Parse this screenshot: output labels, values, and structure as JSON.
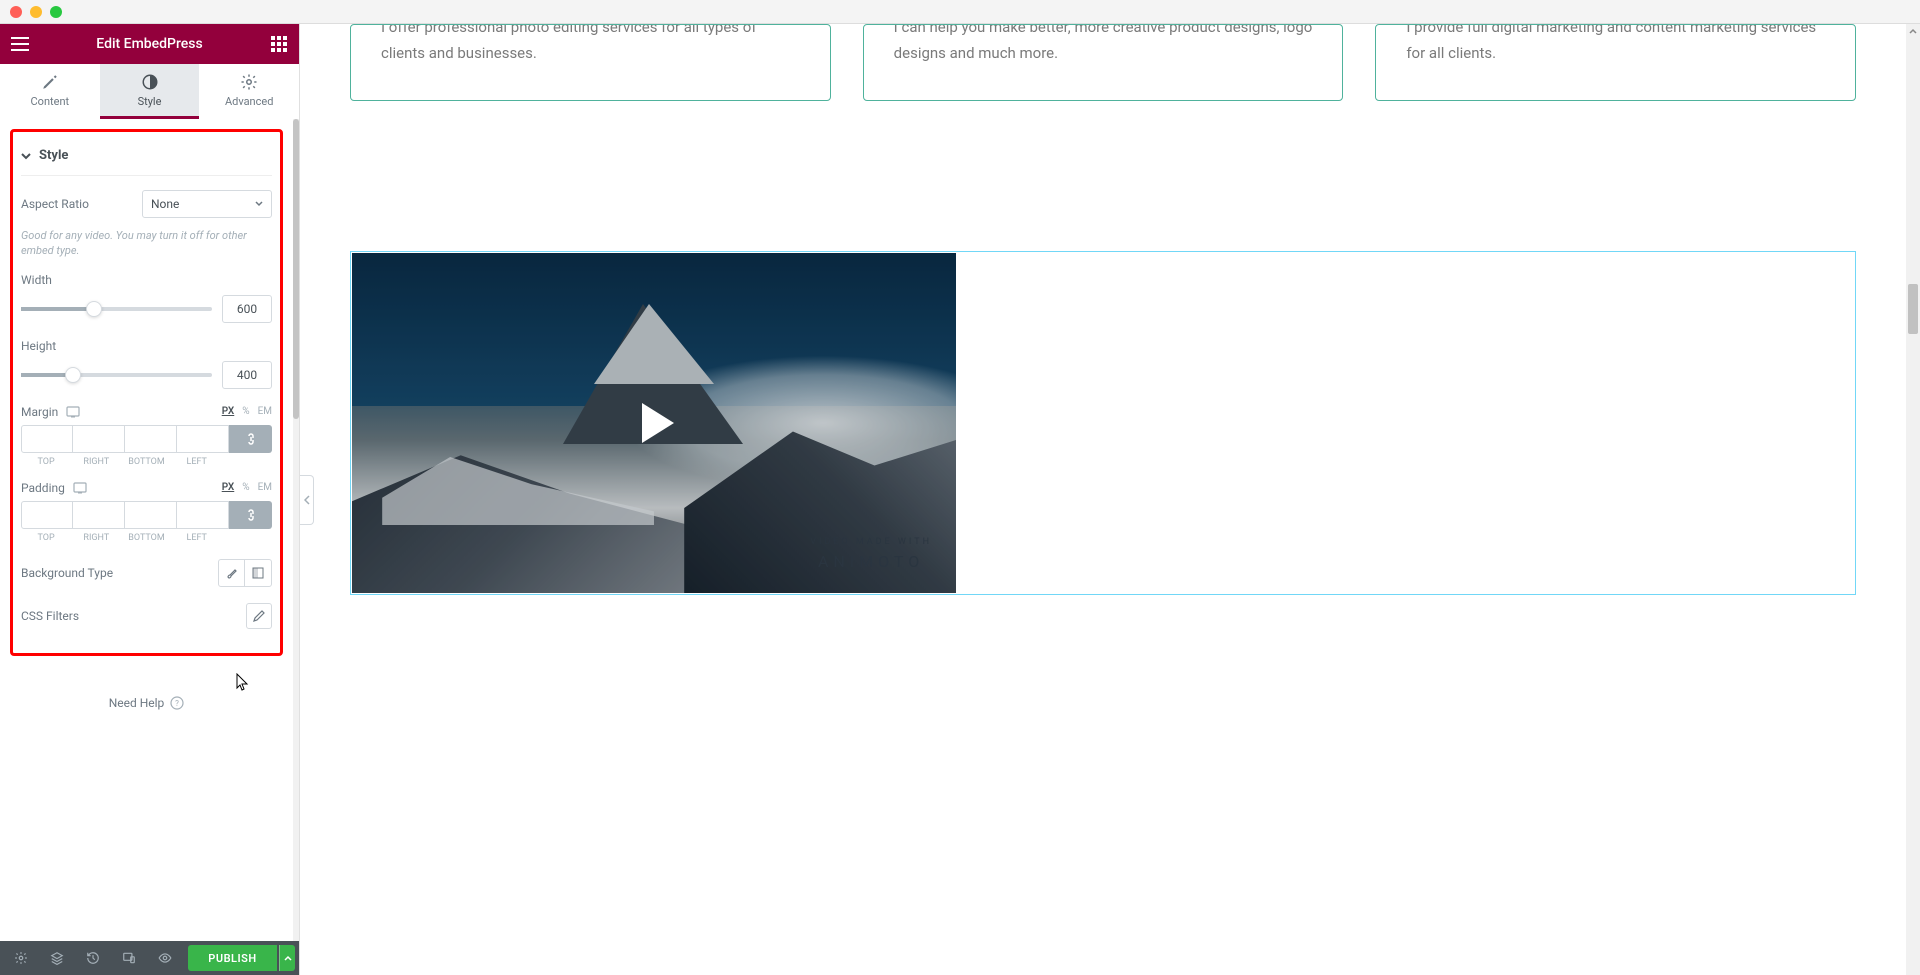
{
  "window": {
    "title": "Edit EmbedPress"
  },
  "tabs": [
    {
      "label": "Content",
      "icon": "pencil"
    },
    {
      "label": "Style",
      "icon": "half-circle"
    },
    {
      "label": "Advanced",
      "icon": "gear"
    }
  ],
  "active_tab": 1,
  "style_panel": {
    "section_title": "Style",
    "aspect_ratio": {
      "label": "Aspect Ratio",
      "value": "None"
    },
    "hint": "Good for any video. You may turn it off for other embed type.",
    "width": {
      "label": "Width",
      "value": "600",
      "percent": 38
    },
    "height": {
      "label": "Height",
      "value": "400",
      "percent": 27
    },
    "margin": {
      "label": "Margin",
      "units": [
        "PX",
        "%",
        "EM"
      ],
      "active_unit": "PX",
      "sides": [
        "TOP",
        "RIGHT",
        "BOTTOM",
        "LEFT"
      ]
    },
    "padding": {
      "label": "Padding",
      "units": [
        "PX",
        "%",
        "EM"
      ],
      "active_unit": "PX",
      "sides": [
        "TOP",
        "RIGHT",
        "BOTTOM",
        "LEFT"
      ]
    },
    "background": {
      "label": "Background Type"
    },
    "css_filters": {
      "label": "CSS Filters"
    }
  },
  "need_help": "Need Help",
  "footer": {
    "publish": "PUBLISH"
  },
  "preview": {
    "cards": [
      "I offer professional photo editing services for all types of clients and businesses.",
      "I can help you make better, more creative product designs, logo designs and much more.",
      "I provide full digital marketing and content marketing services for all clients."
    ],
    "brand_small": "VIDEO MADE WITH",
    "brand_big": "ANIMOTO"
  }
}
